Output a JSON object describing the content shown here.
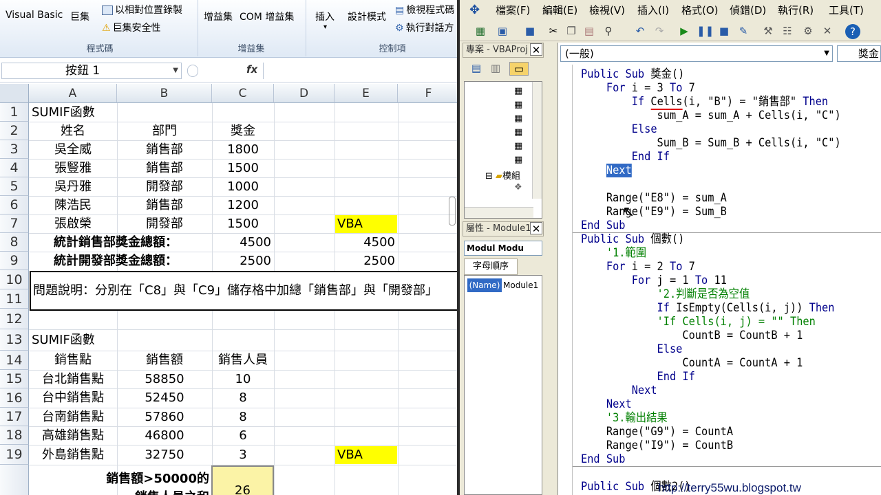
{
  "ribbon": {
    "vb_label": "Visual Basic",
    "macro_label": "巨集",
    "record_relative": "以相對位置錄製",
    "macro_security": "巨集安全性",
    "addins_label": "增益集",
    "com_addins_label": "COM 增益集",
    "insert_label": "插入",
    "design_mode": "設計模式",
    "view_code": "檢視程式碼",
    "run_dialog": "執行對話方",
    "group_code": "程式碼",
    "group_addins": "增益集",
    "group_controls": "控制項"
  },
  "formula": {
    "name_box": "按鈕 1",
    "fx": "fx",
    "content": ""
  },
  "columns": [
    "A",
    "B",
    "C",
    "D",
    "E",
    "F"
  ],
  "rows": [
    "1",
    "2",
    "3",
    "4",
    "5",
    "6",
    "7",
    "8",
    "9",
    "10",
    "11",
    "12",
    "13",
    "14",
    "15",
    "16",
    "17",
    "18",
    "19"
  ],
  "sheet": {
    "r1": "SUMIF函數",
    "h_name": "姓名",
    "h_dept": "部門",
    "h_bonus": "獎金",
    "people": [
      {
        "name": "吳全威",
        "dept": "銷售部",
        "bonus": "1800"
      },
      {
        "name": "張豎雅",
        "dept": "銷售部",
        "bonus": "1500"
      },
      {
        "name": "吳丹雅",
        "dept": "開發部",
        "bonus": "1000"
      },
      {
        "name": "陳浩民",
        "dept": "銷售部",
        "bonus": "1200"
      },
      {
        "name": "張啟榮",
        "dept": "開發部",
        "bonus": "1500"
      }
    ],
    "e7": "VBA",
    "r8_label": "統計銷售部獎金總額：",
    "c8": "4500",
    "e8": "4500",
    "r9_label": "統計開發部獎金總額：",
    "c9": "2500",
    "e9": "2500",
    "note": "問題說明：分別在「C8」與「C9」儲存格中加總「銷售部」與「開發部」",
    "r13": "SUMIF函數",
    "h_point": "銷售點",
    "h_sales": "銷售額",
    "h_staff": "銷售人員",
    "points": [
      {
        "name": "台北銷售點",
        "sales": "58850",
        "staff": "10"
      },
      {
        "name": "台中銷售點",
        "sales": "52450",
        "staff": "8"
      },
      {
        "name": "台南銷售點",
        "sales": "57860",
        "staff": "8"
      },
      {
        "name": "高雄銷售點",
        "sales": "46800",
        "staff": "6"
      },
      {
        "name": "外島銷售點",
        "sales": "32750",
        "staff": "3"
      }
    ],
    "e19": "VBA",
    "r20_label": "銷售額>50000的",
    "r21_label": "銷售人員之和",
    "c20": "26"
  },
  "vbe": {
    "menu": [
      "檔案(F)",
      "編輯(E)",
      "檢視(V)",
      "插入(I)",
      "格式(O)",
      "偵錯(D)",
      "執行(R)",
      "工具(T)"
    ],
    "project_title": "專案 - VBAProj",
    "folder_label": "模組",
    "props_title": "屬性 - Module1",
    "props_combo": "Modul Modu",
    "props_tab": "字母順序",
    "props_name_key": "(Name)",
    "props_name_val": "Module1",
    "object_combo": "(一般)",
    "proc_combo": "獎金",
    "watermark": "http://terry55wu.blogspot.tw"
  }
}
